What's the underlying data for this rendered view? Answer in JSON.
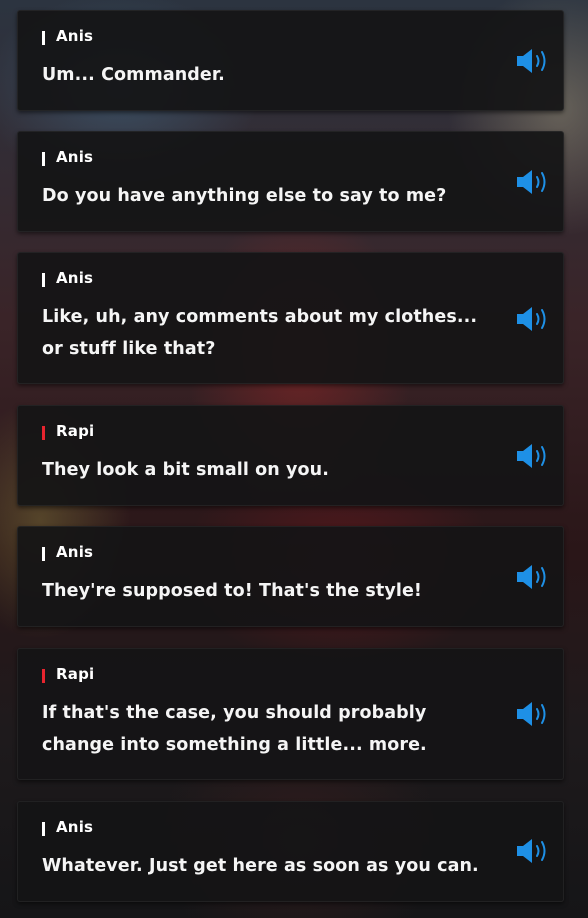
{
  "dialogue": [
    {
      "speaker": "Anis",
      "speaker_color": "#ffffff",
      "text": "Um... Commander."
    },
    {
      "speaker": "Anis",
      "speaker_color": "#ffffff",
      "text": "Do you have anything else to say to me?"
    },
    {
      "speaker": "Anis",
      "speaker_color": "#ffffff",
      "text": "Like, uh, any comments about my clothes... or stuff like that?"
    },
    {
      "speaker": "Rapi",
      "speaker_color": "#e8242e",
      "text": "They look a bit small on you."
    },
    {
      "speaker": "Anis",
      "speaker_color": "#ffffff",
      "text": "They're supposed to! That's the style!"
    },
    {
      "speaker": "Rapi",
      "speaker_color": "#e8242e",
      "text": "If that's the case, you should probably change into something a little... more."
    },
    {
      "speaker": "Anis",
      "speaker_color": "#ffffff",
      "text": "Whatever. Just get here as soon as you can."
    }
  ],
  "icons": {
    "voice": "speaker-volume-icon"
  },
  "colors": {
    "voice_icon": "#1e90e6",
    "anis_marker": "#ffffff",
    "rapi_marker": "#e8242e"
  }
}
